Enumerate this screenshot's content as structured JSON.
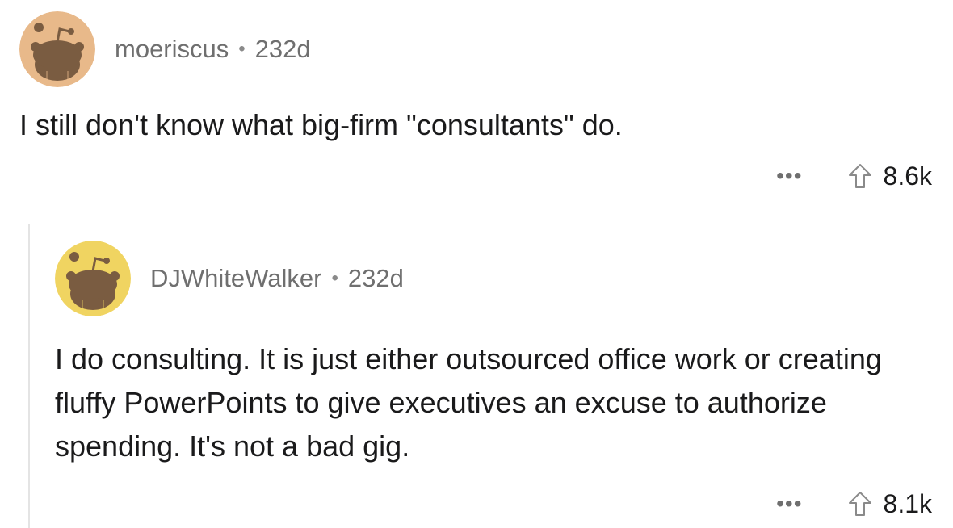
{
  "comments": [
    {
      "username": "moeriscus",
      "separator": "•",
      "age": "232d",
      "body": "I still don't know what big-firm \"consultants\" do.",
      "more_label": "•••",
      "score": "8.6k",
      "avatar_bg": "#e8b98a",
      "icons": {
        "avatar": "reddit-snoo-icon",
        "upvote": "upvote-arrow-icon"
      }
    },
    {
      "username": "DJWhiteWalker",
      "separator": "•",
      "age": "232d",
      "body": "I do consulting. It is just either outsourced office work or creating fluffy PowerPoints to give executives an excuse to authorize spending. It's not a bad gig.",
      "more_label": "•••",
      "score": "8.1k",
      "avatar_bg": "#f0d461",
      "icons": {
        "avatar": "reddit-snoo-icon",
        "upvote": "upvote-arrow-icon"
      }
    }
  ]
}
